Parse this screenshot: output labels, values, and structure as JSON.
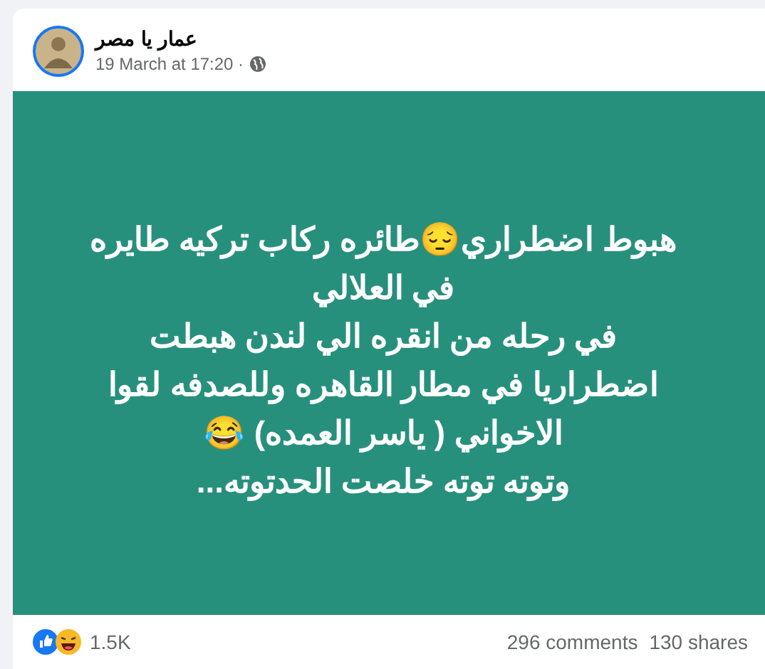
{
  "post": {
    "author": "عمار يا مصر",
    "timestamp": "19 March at 17:20 ·",
    "body_lines": [
      "هبوط اضطراري😔طائره ركاب تركيه طايره",
      "في العلالي",
      "في رحله من انقره الي لندن هبطت",
      "اضطراريا في مطار القاهره وللصدفه لقوا",
      "الاخواني ( ياسر العمده) 😂",
      "وتوته توته خلصت الحدتوته..."
    ]
  },
  "footer": {
    "reactions_count": "1.5K",
    "comments": "296 comments",
    "shares": "130 shares"
  }
}
